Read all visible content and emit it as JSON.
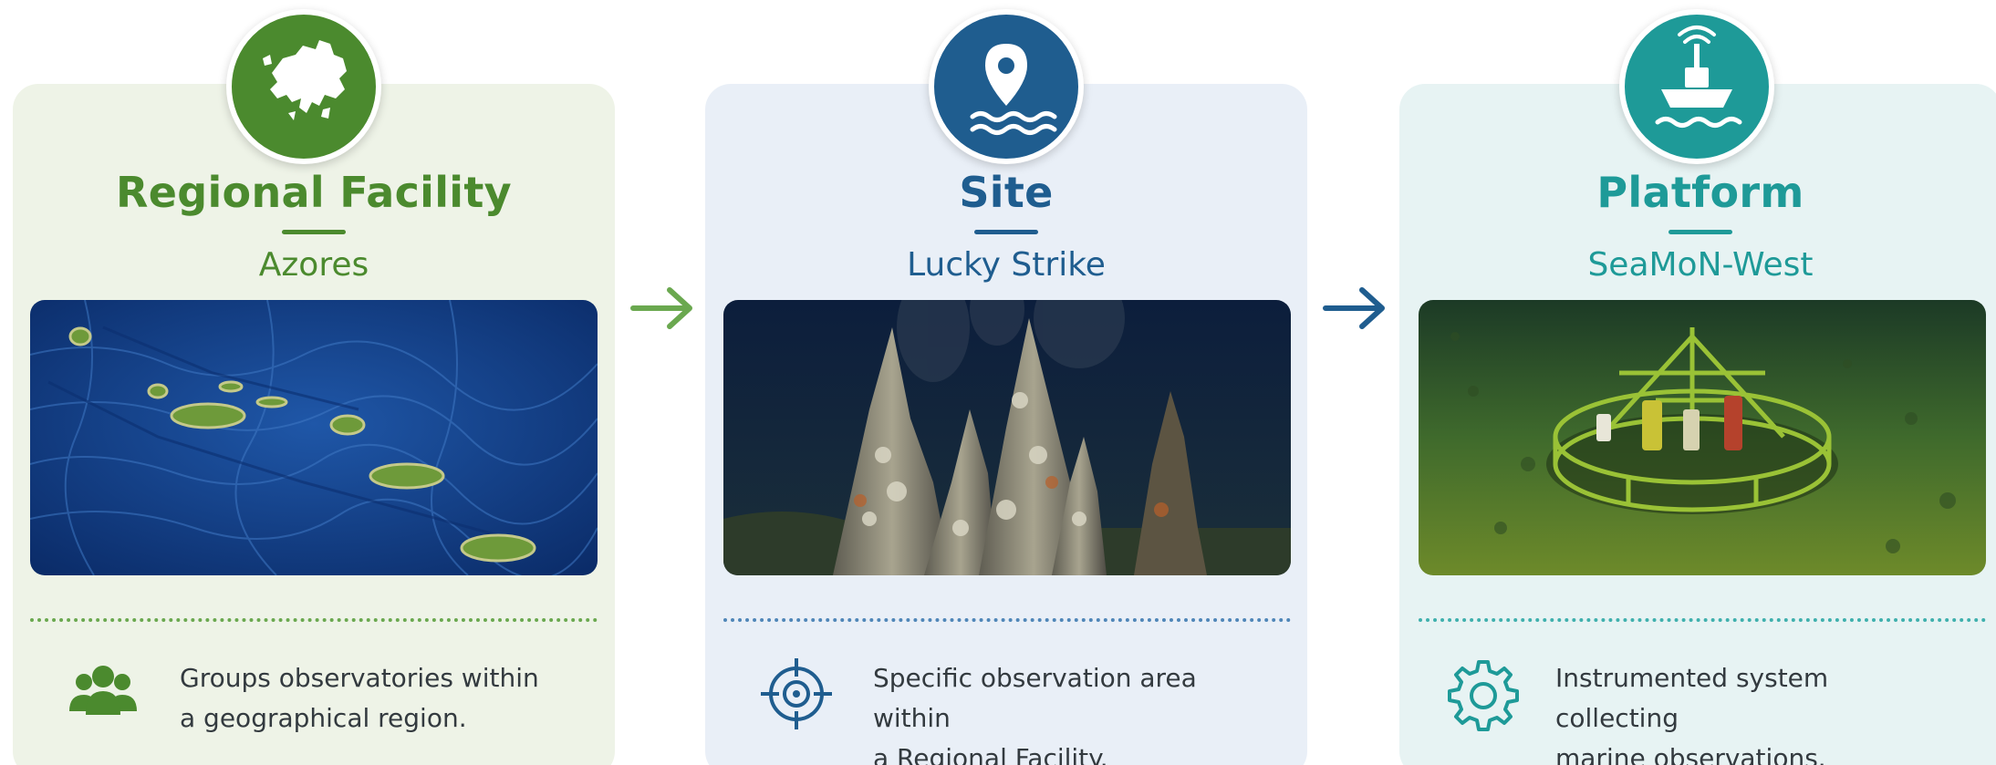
{
  "colors": {
    "green": "#4b8a2e",
    "blue": "#1f5d8f",
    "teal": "#1e9a98",
    "text": "#333a3f"
  },
  "cards": [
    {
      "title": "Regional Facility",
      "subtitle": "Azores",
      "description": [
        "Groups observatories within",
        "a geographical region."
      ],
      "badge_icon": "europe-map-icon",
      "footer_icon": "group-people-icon"
    },
    {
      "title": "Site",
      "subtitle": "Lucky Strike",
      "description": [
        "Specific observation area within",
        "a Regional Facility."
      ],
      "badge_icon": "location-pin-waves-icon",
      "footer_icon": "target-crosshair-icon"
    },
    {
      "title": "Platform",
      "subtitle": "SeaMoN-West",
      "description": [
        "Instrumented system collecting",
        "marine observations."
      ],
      "badge_icon": "ship-antenna-icon",
      "footer_icon": "gear-icon"
    }
  ],
  "connectors": [
    "arrow-right-icon",
    "arrow-right-icon"
  ]
}
